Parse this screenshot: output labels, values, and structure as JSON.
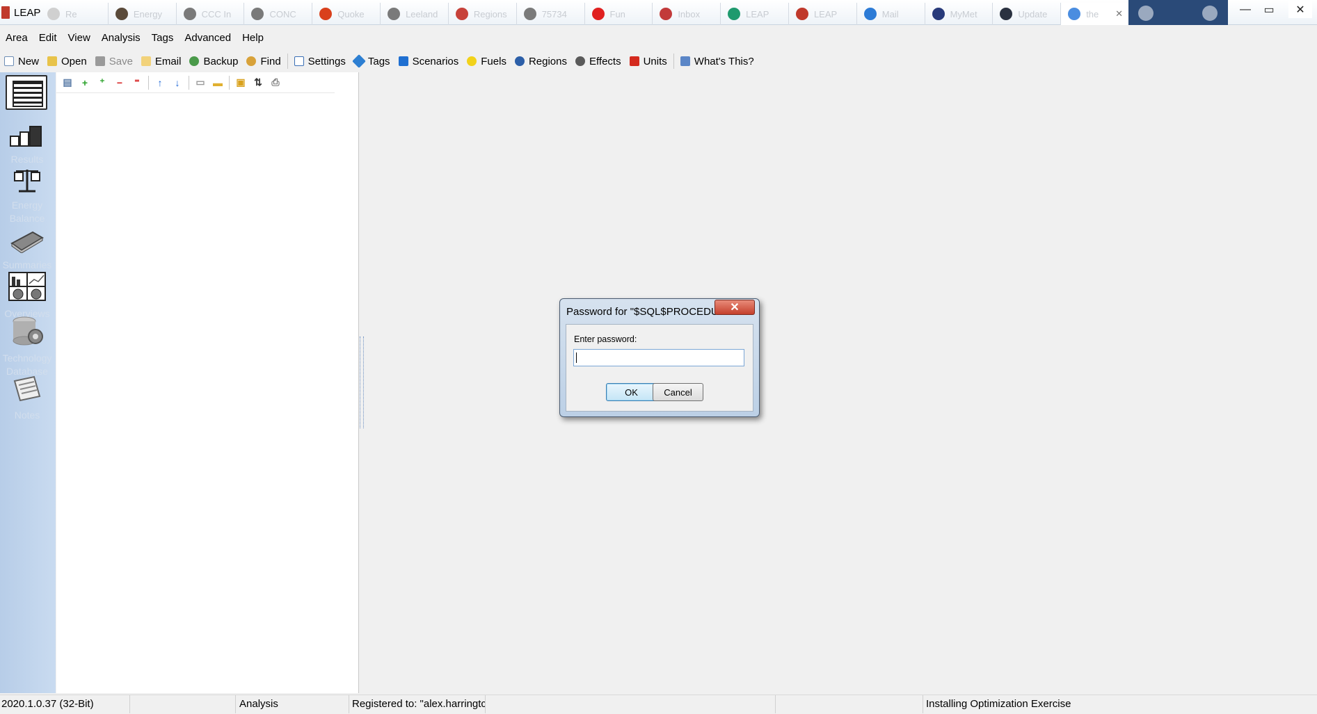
{
  "window": {
    "title": "LEAP",
    "browser_tabs": [
      {
        "label": "Re",
        "color": "#d0d0d0"
      },
      {
        "label": "Energy",
        "color": "#5a4a3a"
      },
      {
        "label": "CCC In",
        "color": "#7a7a7a"
      },
      {
        "label": "CONC",
        "color": "#7a7a7a"
      },
      {
        "label": "Quoke",
        "color": "#d9401c"
      },
      {
        "label": "Leeland",
        "color": "#7a7a7a"
      },
      {
        "label": "Regions",
        "color": "#c7423a"
      },
      {
        "label": "75734",
        "color": "#7a7a7a"
      },
      {
        "label": "Fun",
        "color": "#e02020"
      },
      {
        "label": "Inbox",
        "color": "#c23a3a"
      },
      {
        "label": "LEAP",
        "color": "#1f9a6e"
      },
      {
        "label": "LEAP",
        "color": "#c0392b"
      },
      {
        "label": "Mail",
        "color": "#2c7bd6"
      },
      {
        "label": "MyMet",
        "color": "#283a7a"
      },
      {
        "label": "Update",
        "color": "#2a3140"
      },
      {
        "label": "the",
        "color": "#4a8de0",
        "active": true
      }
    ],
    "controls": {
      "minimize": "—",
      "maximize": "▭",
      "close": "✕"
    }
  },
  "menubar": [
    "Area",
    "Edit",
    "View",
    "Analysis",
    "Tags",
    "Advanced",
    "Help"
  ],
  "toolbar": {
    "new": "New",
    "open": "Open",
    "save": "Save",
    "email": "Email",
    "backup": "Backup",
    "find": "Find",
    "settings": "Settings",
    "tags": "Tags",
    "scenarios": "Scenarios",
    "fuels": "Fuels",
    "regions": "Regions",
    "effects": "Effects",
    "units": "Units",
    "whats_this": "What's This?"
  },
  "left_views": {
    "results": "Results",
    "energy_balance_1": "Energy",
    "energy_balance_2": "Balance",
    "summaries": "Summaries",
    "overviews": "Overviews",
    "tech_db_1": "Technology",
    "tech_db_2": "Database",
    "notes": "Notes"
  },
  "tree_toolbar_icons": [
    "properties-icon",
    "add-icon",
    "add-child-icon",
    "delete-icon",
    "delete-branch-icon",
    "move-up-icon",
    "move-down-icon",
    "collapse-icon",
    "expand-icon",
    "lock-icon",
    "sort-icon",
    "print-icon"
  ],
  "status": {
    "version": "2020.1.0.37 (32-Bit)",
    "blank1": "",
    "view": "Analysis",
    "registered": "Registered to: \"alex.harringtc",
    "blank2": "",
    "blank3": "",
    "area": "Installing Optimization Exercise"
  },
  "dialog": {
    "title": "Password for \"$SQL$PROCEDU...",
    "label": "Enter password:",
    "input_value": "",
    "ok": "OK",
    "cancel": "Cancel",
    "close": "✕"
  },
  "colors": {
    "leftbar": "#c2d6ee",
    "dialog_frame": "#c9d9ea",
    "close_red": "#c9462f"
  }
}
